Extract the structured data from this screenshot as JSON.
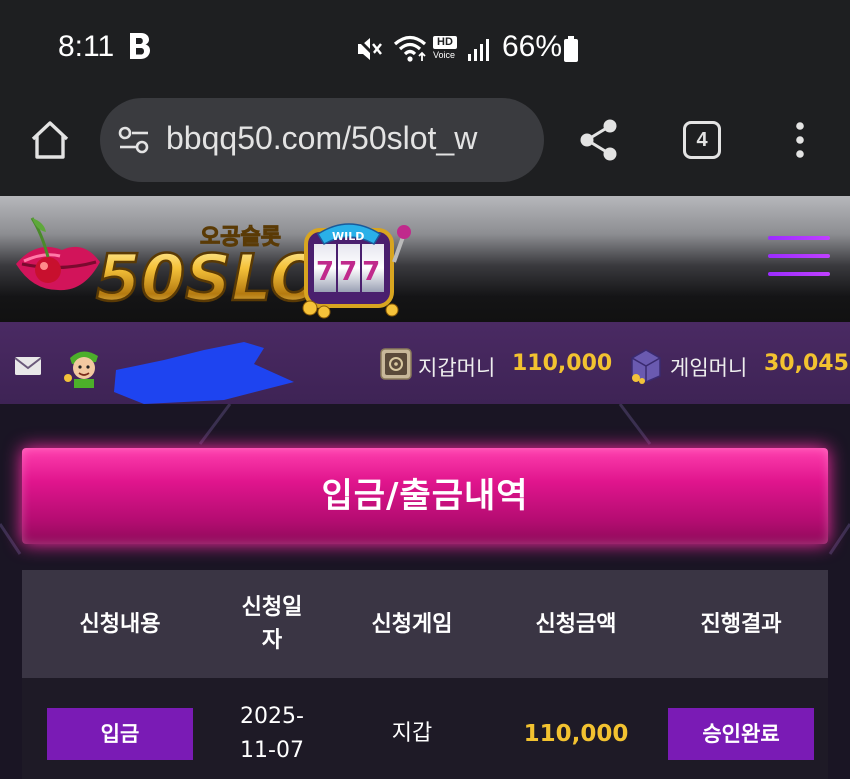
{
  "status_bar": {
    "time": "8:11",
    "battery_percent": "66%",
    "icons": [
      "b-app-icon",
      "mute-icon",
      "wifi-icon",
      "hd-voice-icon",
      "signal-icon",
      "battery-icon"
    ],
    "hd_label": "HD",
    "voice_label": "Voice"
  },
  "browser": {
    "url": "bbqq50.com/50slot_w",
    "tab_count": "4"
  },
  "site": {
    "logo_text": "50SLOT",
    "logo_korean": "오공슬롯",
    "logo_wild": "WILD",
    "logo_reels": "777"
  },
  "user_bar": {
    "wallet_label": "지갑머니",
    "wallet_value": "110,000",
    "game_label": "게임머니",
    "game_value": "30,045"
  },
  "page": {
    "title": "입금/출금내역"
  },
  "table": {
    "headers": [
      "신청내용",
      "신청일자",
      "신청게임",
      "신청금액",
      "진행결과"
    ],
    "rows": [
      {
        "type": "입금",
        "date": "2025-11-07",
        "game": "지갑",
        "amount": "110,000",
        "result": "승인완료"
      }
    ]
  },
  "colors": {
    "accent_gold": "#f2c230",
    "banner_pink": "#e0158d",
    "badge_purple": "#7a1bb5",
    "userbar_purple": "#4a2a63"
  }
}
